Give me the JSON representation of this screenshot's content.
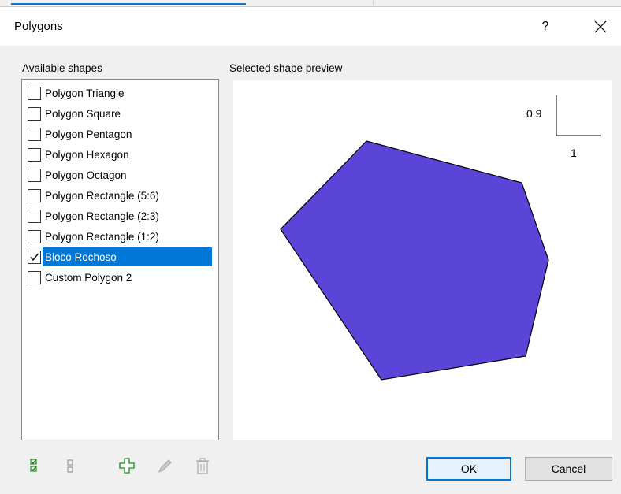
{
  "window": {
    "title": "Polygons",
    "help_label": "?"
  },
  "left_panel": {
    "label": "Available shapes"
  },
  "right_panel": {
    "label": "Selected shape preview",
    "scale_x": "1",
    "scale_y": "0.9",
    "fill_color": "#5b45d8"
  },
  "shapes": [
    {
      "label": "Polygon Triangle",
      "checked": false
    },
    {
      "label": "Polygon Square",
      "checked": false
    },
    {
      "label": "Polygon Pentagon",
      "checked": false
    },
    {
      "label": "Polygon Hexagon",
      "checked": false
    },
    {
      "label": "Polygon Octagon",
      "checked": false
    },
    {
      "label": "Polygon Rectangle (5:6)",
      "checked": false
    },
    {
      "label": "Polygon Rectangle (2:3)",
      "checked": false
    },
    {
      "label": "Polygon Rectangle (1:2)",
      "checked": false
    },
    {
      "label": "Bloco Rochoso",
      "checked": true,
      "selected": true
    },
    {
      "label": "Custom Polygon 2",
      "checked": false
    }
  ],
  "toolbar": {
    "icons": [
      "check-all-icon",
      "uncheck-all-icon",
      "add-icon",
      "edit-icon",
      "delete-icon"
    ]
  },
  "buttons": {
    "ok": "OK",
    "cancel": "Cancel"
  }
}
